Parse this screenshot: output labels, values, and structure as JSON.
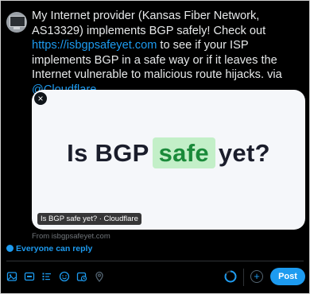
{
  "tweet": {
    "text_before": "My Internet provider (Kansas Fiber Network, AS13329) implements BGP safely! Check out ",
    "link": "https://isbgpsafeyet.com",
    "text_middle": " to see if your ISP implements BGP in a safe way or if it leaves the Internet vulnerable to malicious route hijacks. via ",
    "mention": "@Cloudflare"
  },
  "card": {
    "headline_before": "Is BGP",
    "headline_highlight": "safe",
    "headline_after": "yet?",
    "caption": "Is BGP safe yet? · Cloudflare",
    "source": "From isbgpsafeyet.com",
    "close_icon": "×"
  },
  "reply_setting": {
    "label": "Everyone can reply",
    "icon": "globe-icon"
  },
  "toolbar": {
    "icons": [
      "image-icon",
      "gif-icon",
      "poll-icon",
      "emoji-icon",
      "schedule-icon",
      "location-icon"
    ],
    "add_label": "+",
    "post_label": "Post"
  },
  "colors": {
    "accent": "#1d9bf0",
    "background": "#000000",
    "highlight_bg": "#c3efc8",
    "highlight_fg": "#1a8a3a"
  }
}
